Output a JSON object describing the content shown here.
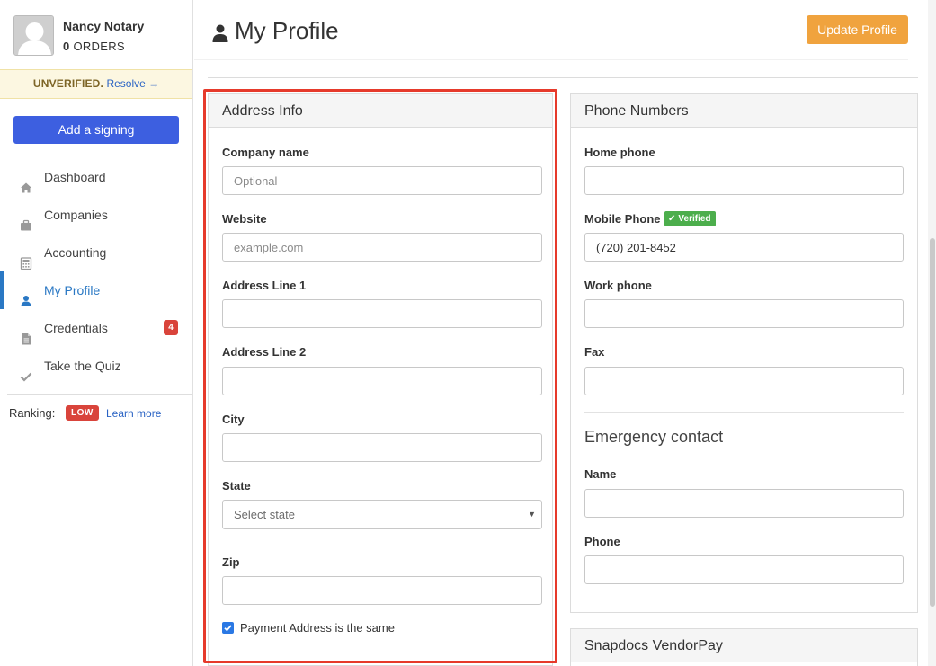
{
  "user": {
    "name": "Nancy Notary",
    "orders_count": "0",
    "orders_label": "ORDERS"
  },
  "verification": {
    "status": "UNVERIFIED.",
    "action": "Resolve →"
  },
  "sidebar": {
    "add_button": "Add a signing",
    "items": [
      {
        "label": "Dashboard",
        "icon": "home-icon"
      },
      {
        "label": "Companies",
        "icon": "briefcase-icon"
      },
      {
        "label": "Accounting",
        "icon": "calculator-icon"
      },
      {
        "label": "My Profile",
        "icon": "user-icon",
        "active": true
      },
      {
        "label": "Credentials",
        "icon": "document-icon",
        "badge": "4"
      },
      {
        "label": "Take the Quiz",
        "icon": "check-icon"
      }
    ],
    "ranking": {
      "label": "Ranking:",
      "level": "LOW",
      "link": "Learn more"
    }
  },
  "header": {
    "title": "My Profile",
    "update_button": "Update Profile"
  },
  "address_info": {
    "title": "Address Info",
    "company_name": {
      "label": "Company name",
      "placeholder": "Optional",
      "value": ""
    },
    "website": {
      "label": "Website",
      "placeholder": "example.com",
      "value": ""
    },
    "address1": {
      "label": "Address Line 1",
      "value": ""
    },
    "address2": {
      "label": "Address Line 2",
      "value": ""
    },
    "city": {
      "label": "City",
      "value": ""
    },
    "state": {
      "label": "State",
      "selected": "Select state"
    },
    "zip": {
      "label": "Zip",
      "value": ""
    },
    "payment_same": {
      "label": "Payment Address is the same",
      "checked": true
    }
  },
  "phone_numbers": {
    "title": "Phone Numbers",
    "home": {
      "label": "Home phone",
      "value": ""
    },
    "mobile": {
      "label": "Mobile Phone",
      "badge": "Verified",
      "value": "(720) 201-8452"
    },
    "work": {
      "label": "Work phone",
      "value": ""
    },
    "fax": {
      "label": "Fax",
      "value": ""
    },
    "emergency": {
      "title": "Emergency contact",
      "name": {
        "label": "Name",
        "value": ""
      },
      "phone": {
        "label": "Phone",
        "value": ""
      }
    }
  },
  "vendorpay": {
    "title": "Snapdocs VendorPay"
  },
  "colors": {
    "primary_button": "#3d5fe0",
    "update_button": "#f0a33e",
    "active_nav": "#2a78c4",
    "badge_red": "#d9443b",
    "verified_green": "#4cae4c",
    "highlight": "#e63a2b"
  }
}
